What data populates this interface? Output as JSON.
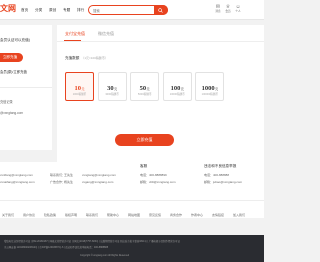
{
  "header": {
    "logo_text": "文网",
    "logo_sub": "",
    "nav": [
      "首页",
      "分类",
      "原创",
      "专题",
      "排行",
      "下载APP"
    ],
    "search_placeholder": "搜索",
    "icons": [
      {
        "name": "message-icon",
        "label": "消息"
      },
      {
        "name": "vip-icon",
        "label": "会员"
      },
      {
        "name": "user-icon",
        "label": "个人"
      }
    ]
  },
  "left": {
    "text1": "会员认证可以充值)",
    "button": "立即充值",
    "text2": "会员(原)/立即充值",
    "text3": "充值记录",
    "text4": "@xxngtang.com"
  },
  "main": {
    "tabs": [
      "支付宝充值",
      "微信充值"
    ],
    "amount_label": "充值数额",
    "amount_hint": "（1元=100稿酬币）",
    "cards": [
      {
        "amount": "10",
        "unit": "元",
        "sub": "1000稿酬币",
        "selected": true
      },
      {
        "amount": "30",
        "unit": "元",
        "sub": "3000稿酬币",
        "selected": false
      },
      {
        "amount": "50",
        "unit": "元",
        "sub": "5000稿酬币",
        "selected": false
      },
      {
        "amount": "100",
        "unit": "元",
        "sub": "10000稿酬币",
        "selected": false
      },
      {
        "amount": "1000",
        "unit": "元",
        "sub": "100000稿酬币",
        "selected": false
      }
    ],
    "pay_button": "立即充值"
  },
  "footer": {
    "col1": [
      "xxnlfang@xxngtang.com",
      "xxnaifang@xxngtang.com"
    ],
    "col2_label1": "联系我们：",
    "col2_val1": "王先生",
    "col2_email1": "xxngtang@xxngtang.com",
    "col2_label2": "广告合作：",
    "col2_val2": "杨先生",
    "col2_email2": "xxgang@xxngtang.com",
    "col3_head": "客服",
    "col3_line1": "电话：400-8888899",
    "col3_line2": "邮箱：xfdt@xxngtang.com",
    "col4_head": "违法和不良信息举报",
    "col4_line1": "电话：400-888888",
    "col4_line2": "邮箱：jubao@xxngtang.com",
    "nav": [
      "关于我们",
      "用户协议",
      "隐私政策",
      "版权声明",
      "联系我们",
      "帮助中心",
      "网站地图",
      "意见反馈",
      "商务合作",
      "作者中心",
      "友情链接",
      "加入我们"
    ],
    "bottom_line1": "增值电信业务经营许可证 京B2-20180187 | 网络文化经营许可证 京网文(2018)7757-683号 | 出版物经营许可证 新出发京批字第直0811号 | 广播电视节目制作经营许可证",
    "bottom_line2": "京公网安备 11010802024812号 | 京ICP备12003387号-6 | 违法和不良信息举报电话：400-8888888",
    "bottom_line3": "Copyright ©xxngtang.com All Rights Reserved"
  }
}
